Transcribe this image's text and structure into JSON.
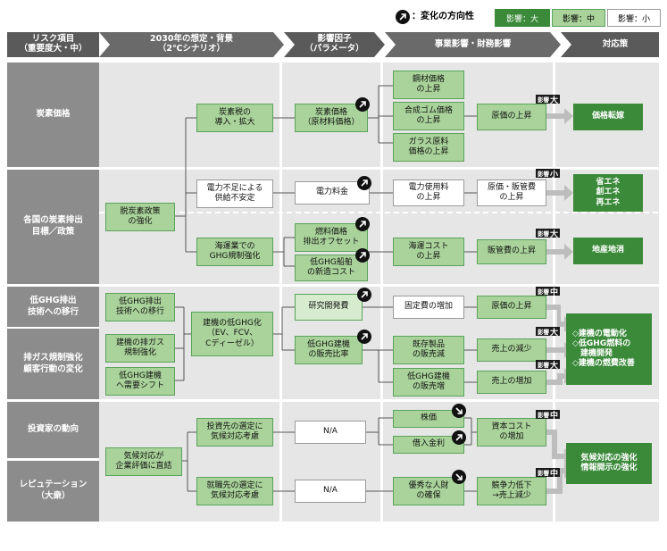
{
  "legend": {
    "direction_label": "：変化の方向性",
    "impact_high": "影響：大",
    "impact_mid": "影響：中",
    "impact_low": "影響：小"
  },
  "headers": {
    "risk": "リスク項目\n（重要度大・中）",
    "scenario": "2030年の想定・背景\n（2℃シナリオ）",
    "factor": "影響因子\n（パラメータ）",
    "impact": "事業影響・財務影響",
    "response": "対応策"
  },
  "rows": {
    "carbon_price": "炭素価格",
    "carbon_policy": "各国の炭素排出\n目標／政策",
    "low_ghg_tech": "低GHG排出\n技術への移行",
    "emission_reg": "排ガス規制強化\n顧客行動の変化",
    "investors": "投資家の動向",
    "reputation": "レピュテーション\n（大衆）"
  },
  "boxes": {
    "decarb_policy": "脱炭素政策\nの強化",
    "carbon_tax": "炭素税の\n導入・拡大",
    "power_shortage": "電力不足による\n供給不安定",
    "shipping_ghg": "海運業での\nGHG規制強化",
    "carbon_price_raw": "炭素価格\n（原材料価格）",
    "electricity_fee": "電力料金",
    "fuel_offset": "燃料価格\n排出オフセット",
    "low_ghg_ship": "低GHG船舶\nの新造コスト",
    "steel_price": "鋼材価格\nの上昇",
    "rubber_price": "合成ゴム価格\nの上昇",
    "glass_price": "ガラス原料\n価格の上昇",
    "power_usage": "電力使用料\nの上昇",
    "shipping_cost": "海運コスト\nの上昇",
    "cost_rise_1": "原価の上昇",
    "cost_sga_rise": "原価・販管費\nの上昇",
    "sga_rise": "販管費の上昇",
    "price_pass": "価格転嫁",
    "energy_save": "省エネ\n創エネ\n再エネ",
    "local_prod": "地産地消",
    "low_ghg_exhaust": "低GHG排出\n技術への移行",
    "exhaust_reg": "建機の排ガス\n規制強化",
    "low_ghg_demand": "低GHG建機\nへ需要シフト",
    "machine_low_ghg": "建機の低GHG化\n（EV、FCV、\nCディーゼル）",
    "rnd_cost": "研究開発費",
    "low_ghg_sales": "低GHG建機\nの販売比率",
    "fixed_cost": "固定費の増加",
    "existing_sales": "既存製品\nの販売減",
    "lowghg_sales_up": "低GHG建機\nの販売増",
    "cost_rise_2": "原価の上昇",
    "sales_down": "売上の減少",
    "sales_up": "売上の増加",
    "electrify": "◇建機の電動化\n◇低GHG燃料の\n　建機開発\n◇建機の燃費改善",
    "climate_eval": "気候対応が\n企業評価に直結",
    "invest_select": "投資先の選定に\n気候対応考慮",
    "job_select": "就職先の選定に\n気候対応考慮",
    "na_1": "N/A",
    "na_2": "N/A",
    "stock_price": "株価",
    "borrow_rate": "借入金利",
    "talent": "優秀な人財\nの確保",
    "capital_cost": "資本コスト\nの増加",
    "competitiveness": "競争力低下\n→売上減少",
    "disclosure": "気候対応の強化\n情報開示の強化"
  },
  "badges": {
    "prefix": "影響",
    "high": "大",
    "mid": "中",
    "low": "小"
  },
  "colors": {
    "header_bg": "#5a5a5a",
    "row_label_bg": "#8c8c8c",
    "column_bg": "#e6e6e6",
    "light_green": "#a9d39a",
    "dark_green": "#3a8a3a"
  },
  "icons": {
    "arrow_up": "arrow-up-right-icon",
    "arrow_down": "arrow-down-right-icon"
  }
}
